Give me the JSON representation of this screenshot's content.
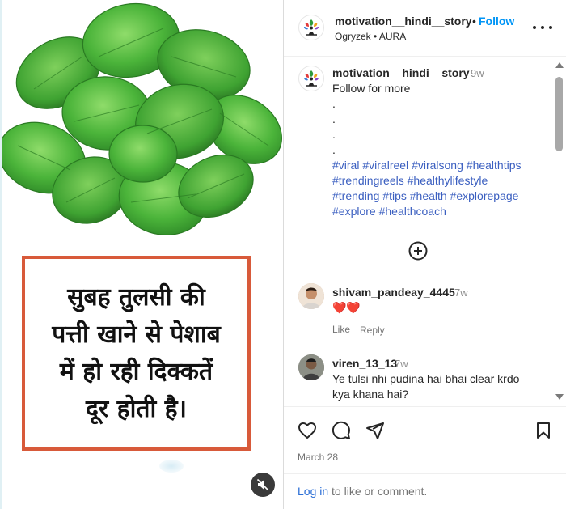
{
  "media": {
    "overlay_text": "सुबह तुलसी की पत्ती खाने से पेशाब में हो रही दिक्कतें दूर होती है।",
    "overlay_lines": [
      "सुबह तुलसी की",
      "पत्ती खाने से पेशाब",
      "में हो रही दिक्कतें",
      "दूर होती है।"
    ],
    "mute_icon": "speaker-muted-icon",
    "accent_border_color": "#d85a3a"
  },
  "header": {
    "username": "motivation__hindi__story",
    "separator": "•",
    "follow_label": "Follow",
    "subtitle": "Ogryzek • AURA",
    "more_icon": "more-options-icon"
  },
  "caption": {
    "username": "motivation__hindi__story",
    "time": "9w",
    "first_line": "Follow for more",
    "dot_lines": [
      ".",
      ".",
      ".",
      "."
    ],
    "hashtags": [
      "#viral",
      "#viralreel",
      "#viralsong",
      "#healthtips",
      "#trendingreels",
      "#healthylifestyle",
      "#trending",
      "#tips",
      "#health",
      "#explorepage",
      "#explore",
      "#healthcoach"
    ]
  },
  "load_more_icon": "add-circle-icon",
  "comments": [
    {
      "username": "shivam_pandeay_4445",
      "time": "7w",
      "text": "❤️❤️",
      "like_label": "Like",
      "reply_label": "Reply"
    },
    {
      "username": "viren_13_13",
      "time": "7w",
      "text_lines": [
        "Ye tulsi nhi pudina hai bhai clear krdo",
        "kya khana hai?"
      ]
    }
  ],
  "actions": {
    "like_icon": "heart-icon",
    "comment_icon": "comment-icon",
    "share_icon": "share-icon",
    "save_icon": "bookmark-icon",
    "date": "March 28"
  },
  "login": {
    "link_text": "Log in",
    "rest_text": " to like or comment."
  },
  "colors": {
    "follow": "#0095f6",
    "hashtag": "#3b5fc0",
    "muted_text": "#737373"
  }
}
